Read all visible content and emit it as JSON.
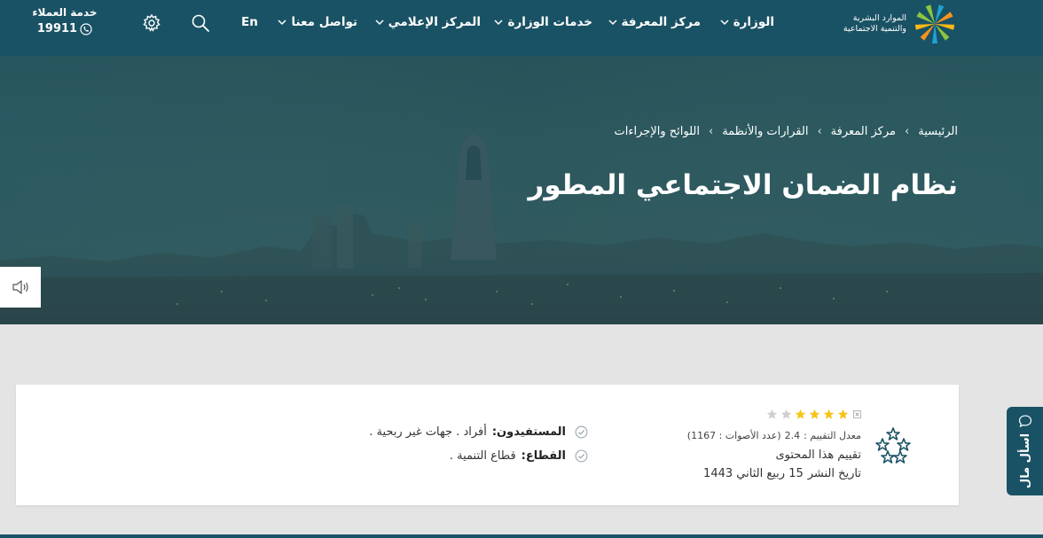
{
  "header": {
    "logo_line1": "الموارد البشرية",
    "logo_line2": "والتنمية الاجتماعية",
    "nav": [
      {
        "label": "الوزارة"
      },
      {
        "label": "مركز المعرفة"
      },
      {
        "label": "خدمات الوزارة"
      },
      {
        "label": "المركز الإعلامي"
      },
      {
        "label": "تواصل معنا"
      }
    ],
    "lang_label": "En",
    "customer_service_title": "خدمة العملاء",
    "customer_service_phone": "19911"
  },
  "hero": {
    "breadcrumb": [
      "الرئيسية",
      "مركز المعرفة",
      "القرارات والأنظمة",
      "اللوائح والإجراءات"
    ],
    "breadcrumb_separator": "›",
    "title": "نظام الضمان الاجتماعي المطور"
  },
  "rating": {
    "filled_stars": 4,
    "total_stars": 6,
    "stats_label": "معدل التقييم :",
    "stats_value": "2.4",
    "votes_text": "(عدد الأصوات : 1167)",
    "rate_content_link": "تقييم هذا المحتوى",
    "publish_label": "تاريخ النشر",
    "publish_date": "15 ربيع الثاني 1443"
  },
  "meta": {
    "beneficiaries_label": "المستفيدون:",
    "beneficiaries_value": "أفراد . جهات غير ربحية .",
    "sector_label": "القطاع:",
    "sector_value": "قطاع التنمية ."
  },
  "ask_tab": {
    "label": "اسأل مال"
  },
  "colors": {
    "header_bg": "#1a5265",
    "star_filled": "#f5c518",
    "star_empty": "#cfcfcf",
    "rate_icon": "#1a5265",
    "check": "#9aa8ad"
  },
  "icons": {
    "logo": "sunburst-logo-icon",
    "chevron": "chevron-down-icon",
    "search": "search-icon",
    "settings": "gear-icon",
    "phone": "phone-icon",
    "audio": "speaker-icon",
    "rate": "stars-cluster-icon",
    "check": "check-circle-icon",
    "ask": "chat-bubble-icon"
  }
}
